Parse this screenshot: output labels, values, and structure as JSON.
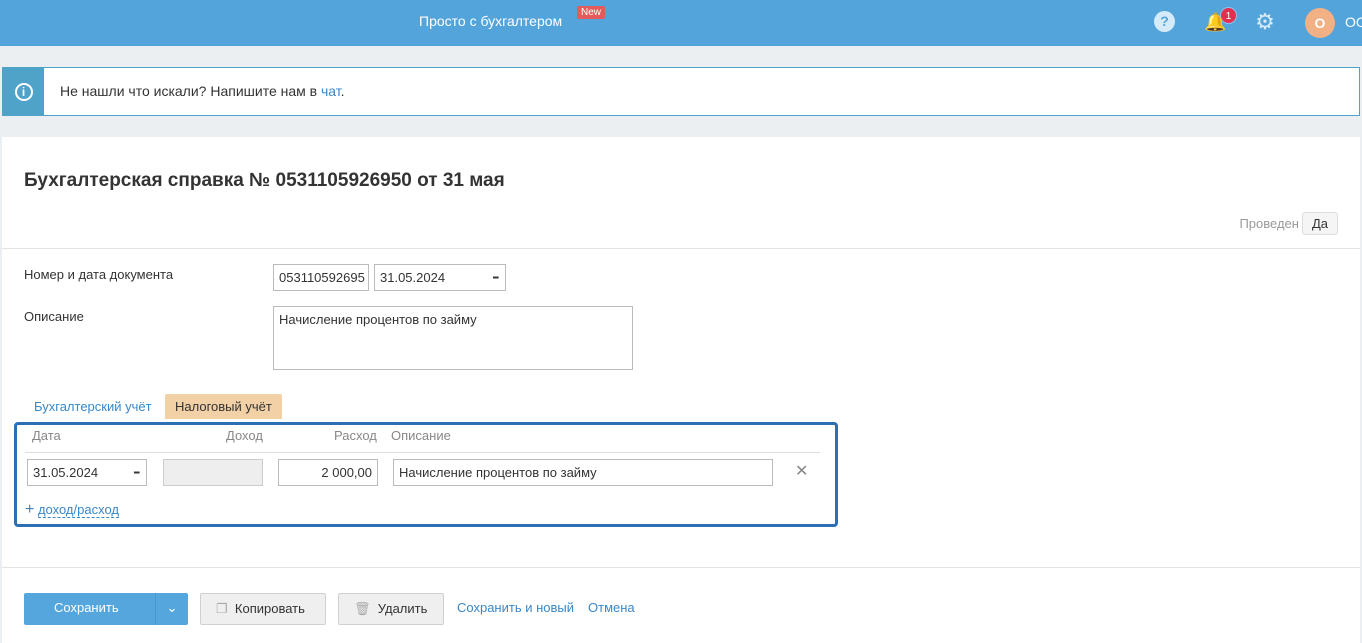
{
  "header": {
    "brand": "Просто с бухгалтером",
    "new_badge": "New",
    "notifications_count": "1",
    "avatar_letter": "О",
    "user": "ОО"
  },
  "info": {
    "text": "Не нашли что искали? Напишите нам в ",
    "link": "чат",
    "end": "."
  },
  "doc": {
    "title": "Бухгалтерская справка № 0531105926950 от 31 мая",
    "posted_label": "Проведен",
    "posted_value": "Да",
    "number_label": "Номер и дата документа",
    "number": "053110592695",
    "date": "31.05.2024",
    "description_label": "Описание",
    "description": "Начисление процентов по займу"
  },
  "tabs": [
    {
      "label": "Бухгалтерский учёт",
      "active": false
    },
    {
      "label": "Налоговый учёт",
      "active": true
    }
  ],
  "table": {
    "headers": [
      "Дата",
      "Доход",
      "Расход",
      "Описание"
    ],
    "rows": [
      {
        "date": "31.05.2024",
        "income": "",
        "expense": "2 000,00",
        "description": "Начисление процентов по займу"
      }
    ],
    "add_label": "доход/расход"
  },
  "actions": {
    "save": "Сохранить",
    "copy": "Копировать",
    "delete": "Удалить",
    "save_new": "Сохранить и новый",
    "cancel": "Отмена"
  }
}
